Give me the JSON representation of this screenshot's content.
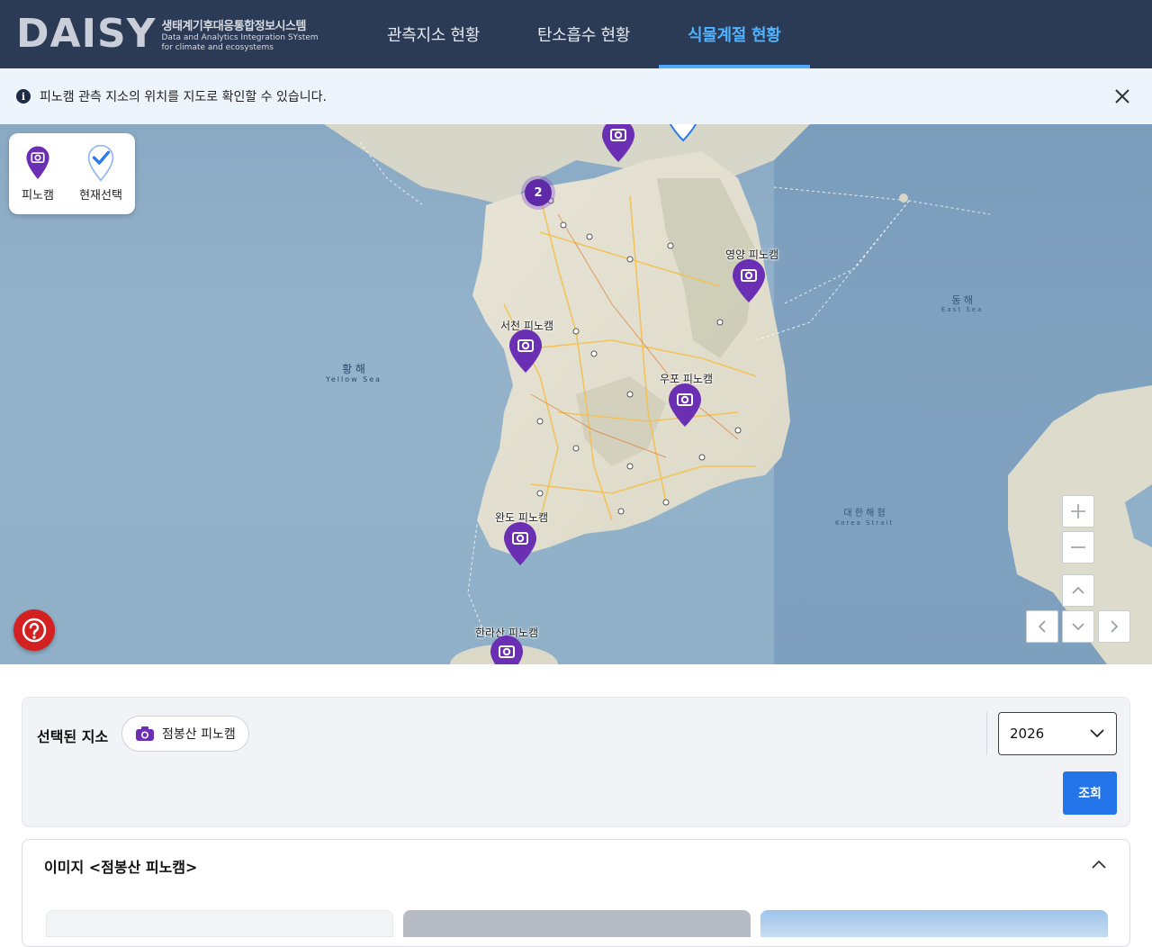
{
  "header": {
    "logo_word": "DAISY",
    "logo_ko": "생태계기후대응통합정보시스템",
    "logo_en1": "Data and Analytics Integration SYstem",
    "logo_en2": "for climate and ecosystems",
    "tabs": [
      {
        "label": "관측지소 현황",
        "active": false
      },
      {
        "label": "탄소흡수 현황",
        "active": false
      },
      {
        "label": "식물계절 현황",
        "active": true
      }
    ]
  },
  "notice": {
    "text": "피노캠 관측 지소의 위치를 지도로 확인할 수 있습니다."
  },
  "map": {
    "legend": {
      "phenocam": "피노캠",
      "current": "현재선택"
    },
    "cluster_count": "2",
    "markers": [
      {
        "label": "영양 피노캠"
      },
      {
        "label": "서천 피노캠"
      },
      {
        "label": "우포 피노캠"
      },
      {
        "label": "완도 피노캠"
      },
      {
        "label": "한라산 피노캠"
      }
    ],
    "sea_labels": {
      "yellow_sea_ko": "황 해",
      "yellow_sea_en": "Yellow Sea",
      "east_sea_ko": "동 해",
      "east_sea_en": "East Sea",
      "strait_ko": "대 한 해 협",
      "strait_en": "Korea Strait"
    },
    "colors": {
      "marker": "#6a2fb3",
      "current": "#2d7be6"
    }
  },
  "selection": {
    "title": "선택된 지소",
    "chip": "점봉산 피노캠",
    "year": "2026",
    "query_label": "조회"
  },
  "images": {
    "title": "이미지 <점봉산 피노캠>"
  }
}
